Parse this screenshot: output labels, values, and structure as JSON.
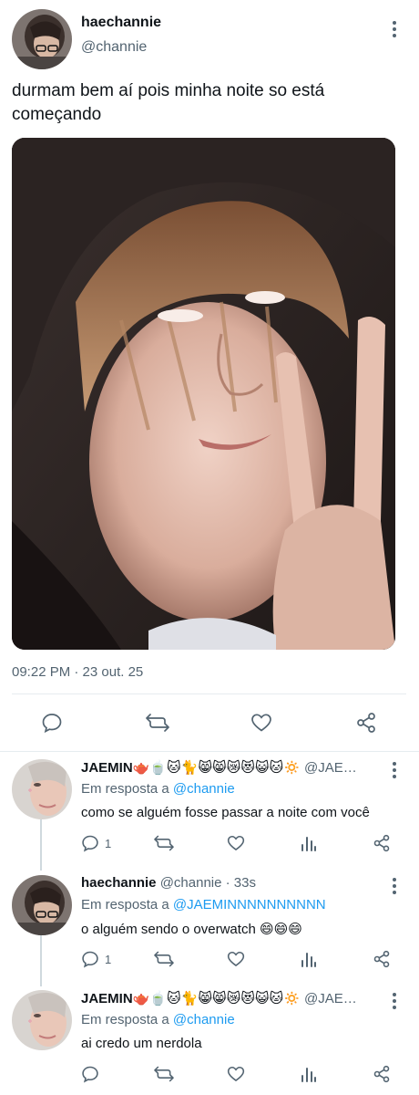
{
  "main": {
    "author_name": "haechannie",
    "author_handle": "@channie",
    "text": "durmam bem aí pois minha noite so está começando",
    "timestamp": "09:22 PM · 23 out. 25"
  },
  "replies": [
    {
      "name": "JAEMIN🫖🍵🐱🐈😸😸😿😻😺🐱🔅",
      "handle_time": "@JAE…",
      "reply_prefix": "Em resposta a ",
      "reply_to": "@channie",
      "text": "como se alguém fosse passar a noite com você",
      "reply_count": "1"
    },
    {
      "name": "haechannie",
      "handle_time": "@channie · 33s",
      "reply_prefix": "Em resposta a ",
      "reply_to": "@JAEMINNNNNNNNNN",
      "text": "o alguém sendo o overwatch 😄😄😄",
      "reply_count": "1"
    },
    {
      "name": "JAEMIN🫖🍵🐱🐈😸😸😿😻😺🐱🔅",
      "handle_time": "@JAE…",
      "reply_prefix": "Em resposta a ",
      "reply_to": "@channie",
      "text": "ai credo um nerdola",
      "reply_count": ""
    }
  ],
  "icons": [
    "reply-icon",
    "retweet-icon",
    "like-icon",
    "share-icon",
    "stats-icon",
    "more-icon"
  ],
  "colors": {
    "link": "#1d9bf0",
    "secondary": "#536471",
    "divider": "#e6ecf0"
  }
}
